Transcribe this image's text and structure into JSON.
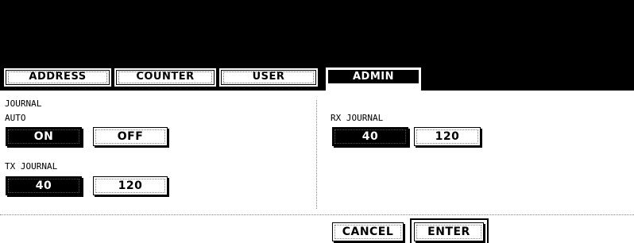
{
  "tabs": [
    {
      "label": "ADDRESS",
      "active": false
    },
    {
      "label": "COUNTER",
      "active": false
    },
    {
      "label": "USER",
      "active": false
    },
    {
      "label": "ADMIN",
      "active": true
    }
  ],
  "section_title": "JOURNAL",
  "auto": {
    "label": "AUTO",
    "on_label": "ON",
    "off_label": "OFF",
    "selected": "ON"
  },
  "tx_journal": {
    "label": "TX JOURNAL",
    "options": [
      "40",
      "120"
    ],
    "selected": "40"
  },
  "rx_journal": {
    "label": "RX JOURNAL",
    "options": [
      "40",
      "120"
    ],
    "selected": "40"
  },
  "footer": {
    "cancel_label": "CANCEL",
    "enter_label": "ENTER"
  },
  "colors": {
    "selected_bg": "#000000",
    "panel_bg": "#ffffff"
  }
}
